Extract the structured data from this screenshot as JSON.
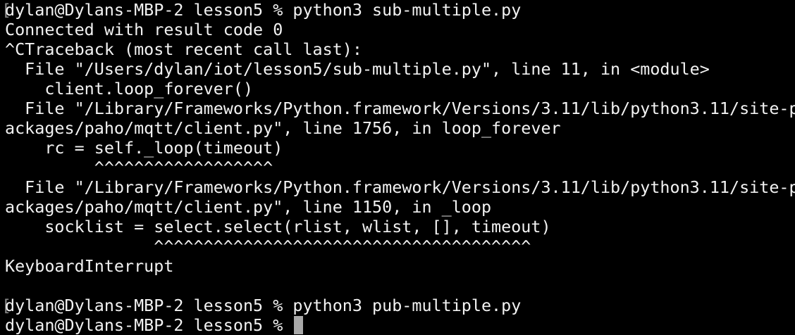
{
  "terminal": {
    "lines": [
      {
        "lead": "[",
        "text": "dylan@Dylans-MBP-2 lesson5 % python3 sub-multiple.py"
      },
      {
        "text": "Connected with result code 0"
      },
      {
        "text": "^CTraceback (most recent call last):"
      },
      {
        "text": "  File \"/Users/dylan/iot/lesson5/sub-multiple.py\", line 11, in <module>"
      },
      {
        "text": "    client.loop_forever()"
      },
      {
        "text": "  File \"/Library/Frameworks/Python.framework/Versions/3.11/lib/python3.11/site-p"
      },
      {
        "text": "ackages/paho/mqtt/client.py\", line 1756, in loop_forever"
      },
      {
        "text": "    rc = self._loop(timeout)"
      },
      {
        "text": "         ^^^^^^^^^^^^^^^^^^"
      },
      {
        "text": "  File \"/Library/Frameworks/Python.framework/Versions/3.11/lib/python3.11/site-p"
      },
      {
        "text": "ackages/paho/mqtt/client.py\", line 1150, in _loop"
      },
      {
        "text": "    socklist = select.select(rlist, wlist, [], timeout)"
      },
      {
        "text": "               ^^^^^^^^^^^^^^^^^^^^^^^^^^^^^^^^^^^^^^"
      },
      {
        "text": "KeyboardInterrupt"
      },
      {
        "text": ""
      },
      {
        "lead": "[",
        "text": "dylan@Dylans-MBP-2 lesson5 % python3 pub-multiple.py"
      }
    ],
    "prompt": "dylan@Dylans-MBP-2 lesson5 % "
  }
}
